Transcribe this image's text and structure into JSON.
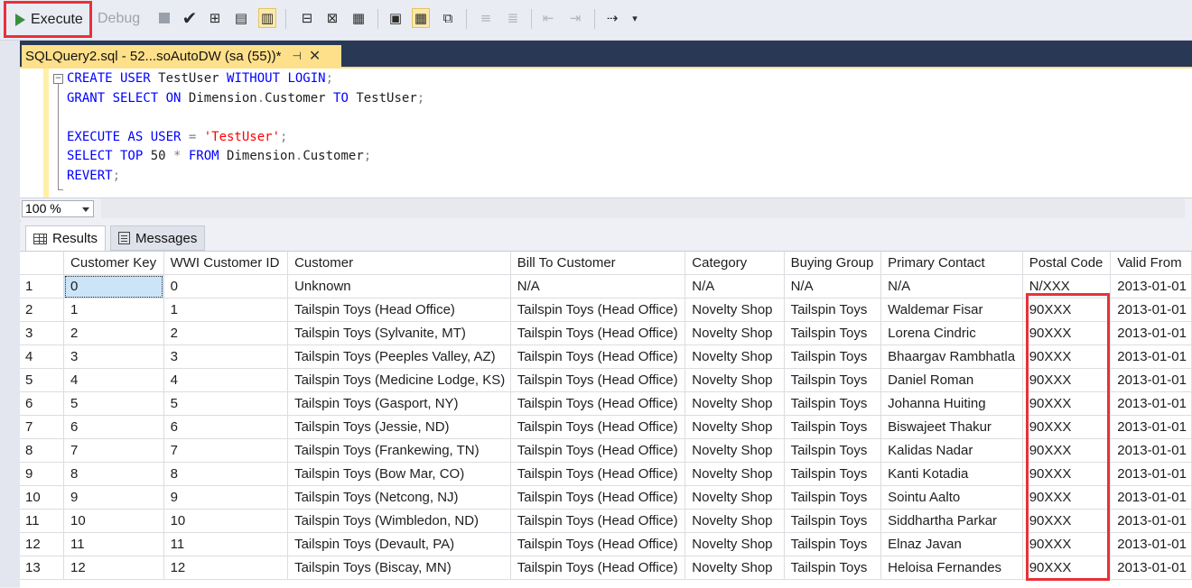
{
  "toolbar": {
    "execute_label": "Execute",
    "debug_label": "Debug",
    "highlight_color": "#e8313a",
    "icons": [
      "stop-icon",
      "parse-check-icon",
      "display-plan-icon",
      "query-options-icon",
      "intellisense-icon",
      "results-to-text-icon",
      "results-to-grid-icon",
      "results-to-file-icon",
      "comment-icon",
      "uncomment-icon",
      "decrease-indent-icon",
      "increase-indent-icon",
      "specify-values-icon",
      "dropdown-icon"
    ]
  },
  "tab": {
    "title": "SQLQuery2.sql - 52...soAutoDW (sa (55))*",
    "pin_icon": "pin-icon",
    "close_icon": "close-icon",
    "accent": "#ffe08a"
  },
  "editor": {
    "lines": [
      [
        [
          "kw",
          "CREATE USER "
        ],
        [
          "id",
          "TestUser "
        ],
        [
          "kw",
          "WITHOUT LOGIN"
        ],
        [
          "op",
          ";"
        ]
      ],
      [
        [
          "kw",
          "GRANT SELECT ON "
        ],
        [
          "id",
          "Dimension"
        ],
        [
          "op",
          "."
        ],
        [
          "id",
          "Customer "
        ],
        [
          "kw",
          "TO "
        ],
        [
          "id",
          "TestUser"
        ],
        [
          "op",
          ";"
        ]
      ],
      [],
      [
        [
          "kw",
          "EXECUTE AS USER "
        ],
        [
          "op",
          "= "
        ],
        [
          "str",
          "'TestUser'"
        ],
        [
          "op",
          ";"
        ]
      ],
      [
        [
          "kw",
          "SELECT TOP "
        ],
        [
          "id",
          "50 "
        ],
        [
          "op",
          "* "
        ],
        [
          "kw",
          "FROM "
        ],
        [
          "id",
          "Dimension"
        ],
        [
          "op",
          "."
        ],
        [
          "id",
          "Customer"
        ],
        [
          "op",
          ";"
        ]
      ],
      [
        [
          "kw",
          "REVERT"
        ],
        [
          "op",
          ";"
        ]
      ]
    ]
  },
  "zoom": {
    "value": "100 %"
  },
  "result_tabs": {
    "results_label": "Results",
    "messages_label": "Messages"
  },
  "grid": {
    "columns": [
      "Customer Key",
      "WWI Customer ID",
      "Customer",
      "Bill To Customer",
      "Category",
      "Buying Group",
      "Primary Contact",
      "Postal Code",
      "Valid From"
    ],
    "rows": [
      [
        "1",
        "0",
        "0",
        "Unknown",
        "N/A",
        "N/A",
        "N/A",
        "N/A",
        "N/XXX",
        "2013-01-01"
      ],
      [
        "2",
        "1",
        "1",
        "Tailspin Toys (Head Office)",
        "Tailspin Toys (Head Office)",
        "Novelty Shop",
        "Tailspin Toys",
        "Waldemar Fisar",
        "90XXX",
        "2013-01-01"
      ],
      [
        "3",
        "2",
        "2",
        "Tailspin Toys (Sylvanite, MT)",
        "Tailspin Toys (Head Office)",
        "Novelty Shop",
        "Tailspin Toys",
        "Lorena Cindric",
        "90XXX",
        "2013-01-01"
      ],
      [
        "4",
        "3",
        "3",
        "Tailspin Toys (Peeples Valley, AZ)",
        "Tailspin Toys (Head Office)",
        "Novelty Shop",
        "Tailspin Toys",
        "Bhaargav Rambhatla",
        "90XXX",
        "2013-01-01"
      ],
      [
        "5",
        "4",
        "4",
        "Tailspin Toys (Medicine Lodge, KS)",
        "Tailspin Toys (Head Office)",
        "Novelty Shop",
        "Tailspin Toys",
        "Daniel Roman",
        "90XXX",
        "2013-01-01"
      ],
      [
        "6",
        "5",
        "5",
        "Tailspin Toys (Gasport, NY)",
        "Tailspin Toys (Head Office)",
        "Novelty Shop",
        "Tailspin Toys",
        "Johanna Huiting",
        "90XXX",
        "2013-01-01"
      ],
      [
        "7",
        "6",
        "6",
        "Tailspin Toys (Jessie, ND)",
        "Tailspin Toys (Head Office)",
        "Novelty Shop",
        "Tailspin Toys",
        "Biswajeet Thakur",
        "90XXX",
        "2013-01-01"
      ],
      [
        "8",
        "7",
        "7",
        "Tailspin Toys (Frankewing, TN)",
        "Tailspin Toys (Head Office)",
        "Novelty Shop",
        "Tailspin Toys",
        "Kalidas Nadar",
        "90XXX",
        "2013-01-01"
      ],
      [
        "9",
        "8",
        "8",
        "Tailspin Toys (Bow Mar, CO)",
        "Tailspin Toys (Head Office)",
        "Novelty Shop",
        "Tailspin Toys",
        "Kanti Kotadia",
        "90XXX",
        "2013-01-01"
      ],
      [
        "10",
        "9",
        "9",
        "Tailspin Toys (Netcong, NJ)",
        "Tailspin Toys (Head Office)",
        "Novelty Shop",
        "Tailspin Toys",
        "Sointu Aalto",
        "90XXX",
        "2013-01-01"
      ],
      [
        "11",
        "10",
        "10",
        "Tailspin Toys (Wimbledon, ND)",
        "Tailspin Toys (Head Office)",
        "Novelty Shop",
        "Tailspin Toys",
        "Siddhartha Parkar",
        "90XXX",
        "2013-01-01"
      ],
      [
        "12",
        "11",
        "11",
        "Tailspin Toys (Devault, PA)",
        "Tailspin Toys (Head Office)",
        "Novelty Shop",
        "Tailspin Toys",
        "Elnaz Javan",
        "90XXX",
        "2013-01-01"
      ],
      [
        "13",
        "12",
        "12",
        "Tailspin Toys (Biscay, MN)",
        "Tailspin Toys (Head Office)",
        "Novelty Shop",
        "Tailspin Toys",
        "Heloisa Fernandes",
        "90XXX",
        "2013-01-01"
      ]
    ]
  }
}
